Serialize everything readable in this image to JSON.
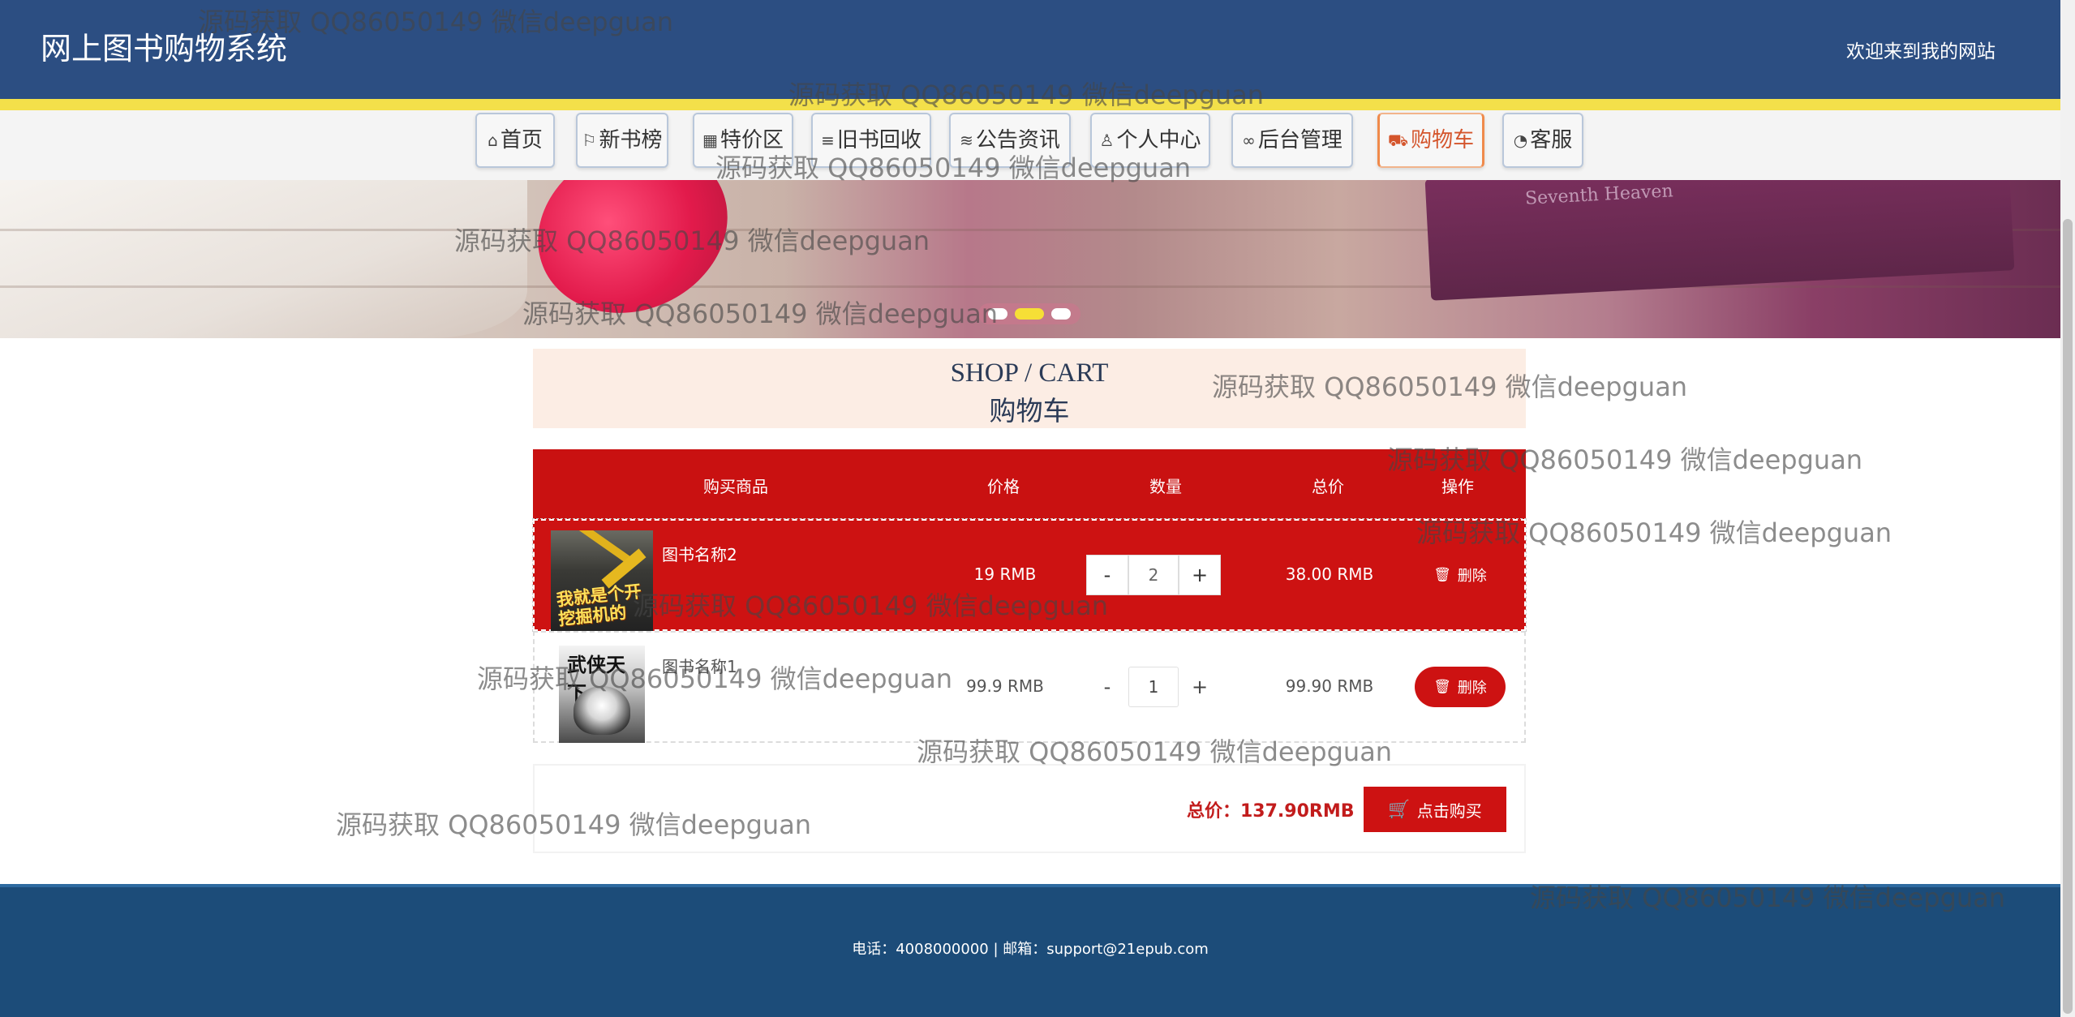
{
  "header": {
    "site_title": "网上图书购物系统",
    "welcome": "欢迎来到我的网站"
  },
  "nav": {
    "items": [
      {
        "label": "首页",
        "icon": "home-icon",
        "glyph": "⌂"
      },
      {
        "label": "新书榜",
        "icon": "flag-icon",
        "glyph": "⚐"
      },
      {
        "label": "特价区",
        "icon": "grid-icon",
        "glyph": "▦"
      },
      {
        "label": "旧书回收",
        "icon": "sliders-icon",
        "glyph": "≡"
      },
      {
        "label": "公告资讯",
        "icon": "layers-icon",
        "glyph": "≋"
      },
      {
        "label": "个人中心",
        "icon": "user-icon",
        "glyph": "♙"
      },
      {
        "label": "后台管理",
        "icon": "link-icon",
        "glyph": "∞"
      },
      {
        "label": "购物车",
        "icon": "cart-icon",
        "glyph": "⛟",
        "active": true
      },
      {
        "label": "客服",
        "icon": "chat-icon",
        "glyph": "◔"
      }
    ]
  },
  "banner": {
    "book_text": "Seventh Heaven",
    "carousel_active_index": 1,
    "carousel_count": 3
  },
  "shop": {
    "title_en": "SHOP / CART",
    "title_zh": "购物车"
  },
  "cart": {
    "columns": [
      "购买商品",
      "价格",
      "数量",
      "总价",
      "操作"
    ],
    "items": [
      {
        "name": "图书名称2",
        "cover_text": "我就是个开挖掘机的",
        "price": "19 RMB",
        "quantity": "2",
        "subtotal": "38.00 RMB",
        "minus": "-",
        "plus": "+",
        "delete_label": "删除"
      },
      {
        "name": "图书名称1",
        "cover_text": "武侠天下",
        "price": "99.9 RMB",
        "quantity": "1",
        "subtotal": "99.90 RMB",
        "minus": "-",
        "plus": "+",
        "delete_label": "删除"
      }
    ],
    "total_label": "总价：137.90RMB",
    "buy_label": "点击购买"
  },
  "footer": {
    "text": "电话：4008000000 | 邮箱：support@21epub.com"
  },
  "watermark": "源码获取 QQ86050149 微信deepguan",
  "colors": {
    "header_bg": "#2c4e82",
    "accent_red": "#cd1212",
    "active_nav": "#d4552c",
    "footer_bg": "#1c4c79"
  }
}
